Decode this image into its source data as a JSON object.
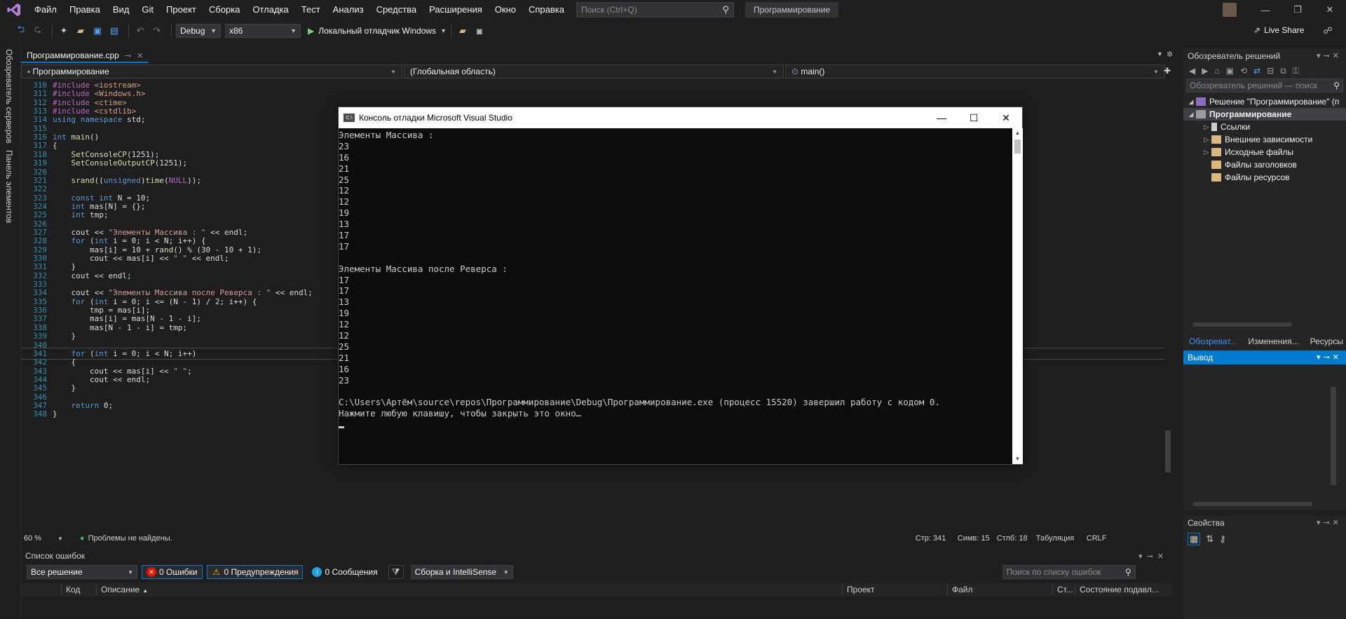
{
  "menu": {
    "items": [
      "Файл",
      "Правка",
      "Вид",
      "Git",
      "Проект",
      "Сборка",
      "Отладка",
      "Тест",
      "Анализ",
      "Средства",
      "Расширения",
      "Окно",
      "Справка"
    ],
    "search_placeholder": "Поиск (Ctrl+Q)",
    "solution_name": "Программирование"
  },
  "toolbar": {
    "config": "Debug",
    "platform": "x86",
    "run_label": "Локальный отладчик Windows",
    "live_share": "Live Share"
  },
  "left_tabs": [
    "Обозреватель серверов",
    "Панель элементов"
  ],
  "editor": {
    "tab_title": "Программирование.cpp",
    "nav_project": "Программирование",
    "nav_scope": "(Глобальная область)",
    "nav_member": "main()",
    "current_line": 341,
    "lines": [
      {
        "n": "310",
        "t": "#include <iostream>"
      },
      {
        "n": "311",
        "t": "#include <Windows.h>"
      },
      {
        "n": "312",
        "t": "#include <ctime>"
      },
      {
        "n": "313",
        "t": "#include <cstdlib>"
      },
      {
        "n": "314",
        "t": "using namespace std;"
      },
      {
        "n": "315",
        "t": ""
      },
      {
        "n": "316",
        "t": "int main()"
      },
      {
        "n": "317",
        "t": "{"
      },
      {
        "n": "318",
        "t": "    SetConsoleCP(1251);"
      },
      {
        "n": "319",
        "t": "    SetConsoleOutputCP(1251);"
      },
      {
        "n": "320",
        "t": ""
      },
      {
        "n": "321",
        "t": "    srand((unsigned)time(NULL));"
      },
      {
        "n": "322",
        "t": ""
      },
      {
        "n": "323",
        "t": "    const int N = 10;"
      },
      {
        "n": "324",
        "t": "    int mas[N] = {};"
      },
      {
        "n": "325",
        "t": "    int tmp;"
      },
      {
        "n": "326",
        "t": ""
      },
      {
        "n": "327",
        "t": "    cout << \"Элементы Массива : \" << endl;"
      },
      {
        "n": "328",
        "t": "    for (int i = 0; i < N; i++) {"
      },
      {
        "n": "329",
        "t": "        mas[i] = 10 + rand() % (30 - 10 + 1);"
      },
      {
        "n": "330",
        "t": "        cout << mas[i] << \" \" << endl;"
      },
      {
        "n": "331",
        "t": "    }"
      },
      {
        "n": "332",
        "t": "    cout << endl;"
      },
      {
        "n": "333",
        "t": ""
      },
      {
        "n": "334",
        "t": "    cout << \"Элементы Массива после Реверса : \" << endl;"
      },
      {
        "n": "335",
        "t": "    for (int i = 0; i <= (N - 1) / 2; i++) {"
      },
      {
        "n": "336",
        "t": "        tmp = mas[i];"
      },
      {
        "n": "337",
        "t": "        mas[i] = mas[N - 1 - i];"
      },
      {
        "n": "338",
        "t": "        mas[N - 1 - i] = tmp;"
      },
      {
        "n": "339",
        "t": "    }"
      },
      {
        "n": "340",
        "t": ""
      },
      {
        "n": "341",
        "t": "    for (int i = 0; i < N; i++)"
      },
      {
        "n": "342",
        "t": "    {"
      },
      {
        "n": "343",
        "t": "        cout << mas[i] << \" \";"
      },
      {
        "n": "344",
        "t": "        cout << endl;"
      },
      {
        "n": "345",
        "t": "    }"
      },
      {
        "n": "346",
        "t": ""
      },
      {
        "n": "347",
        "t": "    return 0;"
      },
      {
        "n": "348",
        "t": "}"
      }
    ]
  },
  "status": {
    "zoom": "60 %",
    "problems": "Проблемы не найдены.",
    "line": "Стр: 341",
    "char": "Симв: 15",
    "col": "Стлб: 18",
    "indent": "Табуляция",
    "eol": "CRLF"
  },
  "error_list": {
    "title": "Список ошибок",
    "scope": "Все решение",
    "errors": "0 Ошибки",
    "warnings": "0 Предупреждения",
    "messages": "0 Сообщения",
    "build_filter": "Сборка и IntelliSense",
    "search_placeholder": "Поиск по списку ошибок",
    "columns": [
      "Код",
      "Описание",
      "Проект",
      "Файл",
      "Ст...",
      "Состояние подавл..."
    ]
  },
  "solution_explorer": {
    "title": "Обозреватель решений",
    "search_placeholder": "Обозреватель решений — поиск",
    "solution": "Решение \"Программирование\" (п",
    "project": "Программирование",
    "nodes": [
      "Ссылки",
      "Внешние зависимости",
      "Исходные файлы",
      "Файлы заголовков",
      "Файлы ресурсов"
    ],
    "tabs": [
      "Обозреват...",
      "Изменения...",
      "Ресурсы"
    ]
  },
  "output": {
    "title": "Вывод"
  },
  "properties": {
    "title": "Свойства"
  },
  "console": {
    "title": "Консоль отладки Microsoft Visual Studio",
    "lines": [
      "Элементы Массива :",
      "23",
      "16",
      "21",
      "25",
      "12",
      "12",
      "19",
      "13",
      "17",
      "17",
      "",
      "Элементы Массива после Реверса :",
      "17",
      "17",
      "13",
      "19",
      "12",
      "12",
      "25",
      "21",
      "16",
      "23",
      "",
      "C:\\Users\\Артём\\source\\repos\\Программирование\\Debug\\Программирование.exe (процесс 15520) завершил работу с кодом 0.",
      "Нажмите любую клавишу, чтобы закрыть это окно…"
    ]
  },
  "colors": {
    "accent": "#007acc",
    "keyword": "#569cd6",
    "string": "#d69d85",
    "function": "#dcdcaa",
    "line_number": "#2b91af"
  }
}
